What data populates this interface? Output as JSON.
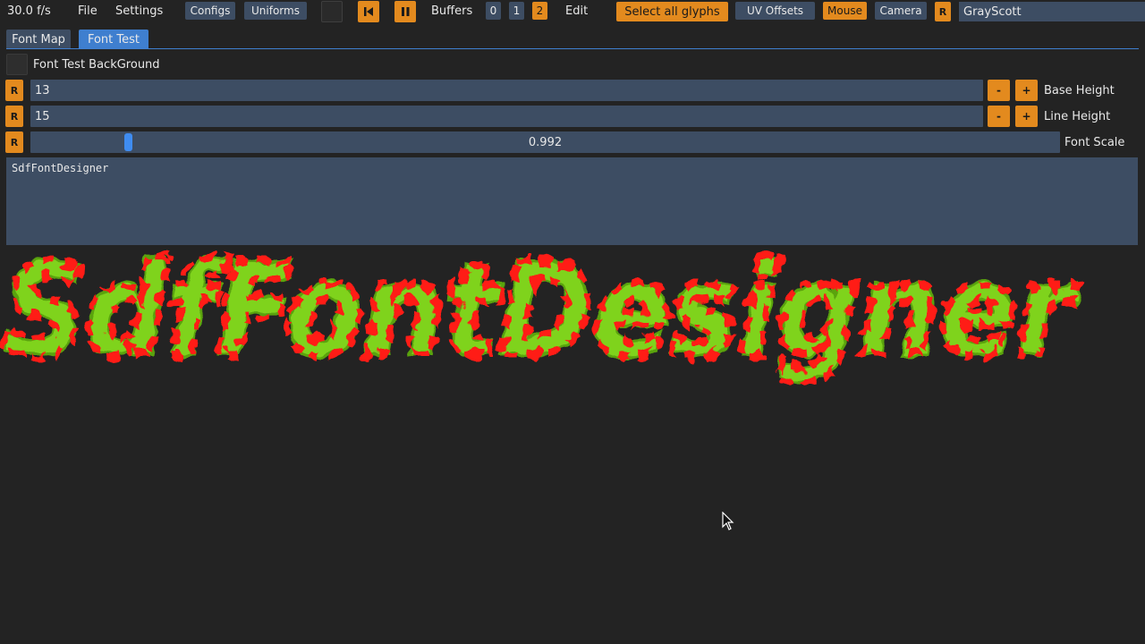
{
  "menubar": {
    "fps": "30.0 f/s",
    "file": "File",
    "settings": "Settings",
    "configs": "Configs",
    "uniforms": "Uniforms",
    "buffers_label": "Buffers",
    "buffers": [
      "0",
      "1",
      "2"
    ],
    "edit": "Edit",
    "select_all_glyphs": "Select all glyphs",
    "uv_offsets": "UV Offsets",
    "mouse": "Mouse",
    "camera": "Camera",
    "reset": "R",
    "shader_name": "GrayScott"
  },
  "tabs": [
    "Font Map",
    "Font Test"
  ],
  "font_test": {
    "background_label": "Font Test BackGround",
    "reset": "R",
    "minus": "-",
    "plus": "+",
    "base_height": {
      "value": "13",
      "label": "Base Height"
    },
    "line_height": {
      "value": "15",
      "label": "Line Height"
    },
    "font_scale": {
      "value": "0.992",
      "label": "Font Scale"
    },
    "text_input": "SdfFontDesigner",
    "preview_text": "SdfFontDesigner"
  },
  "colors": {
    "panel": "#3d4d63",
    "accent_orange": "#e38a1e",
    "tab_active": "#3f7fcf",
    "slider_grab": "#3f8cf0",
    "glyph_outer": "#7fd31e",
    "glyph_inner": "#ff1a14"
  }
}
